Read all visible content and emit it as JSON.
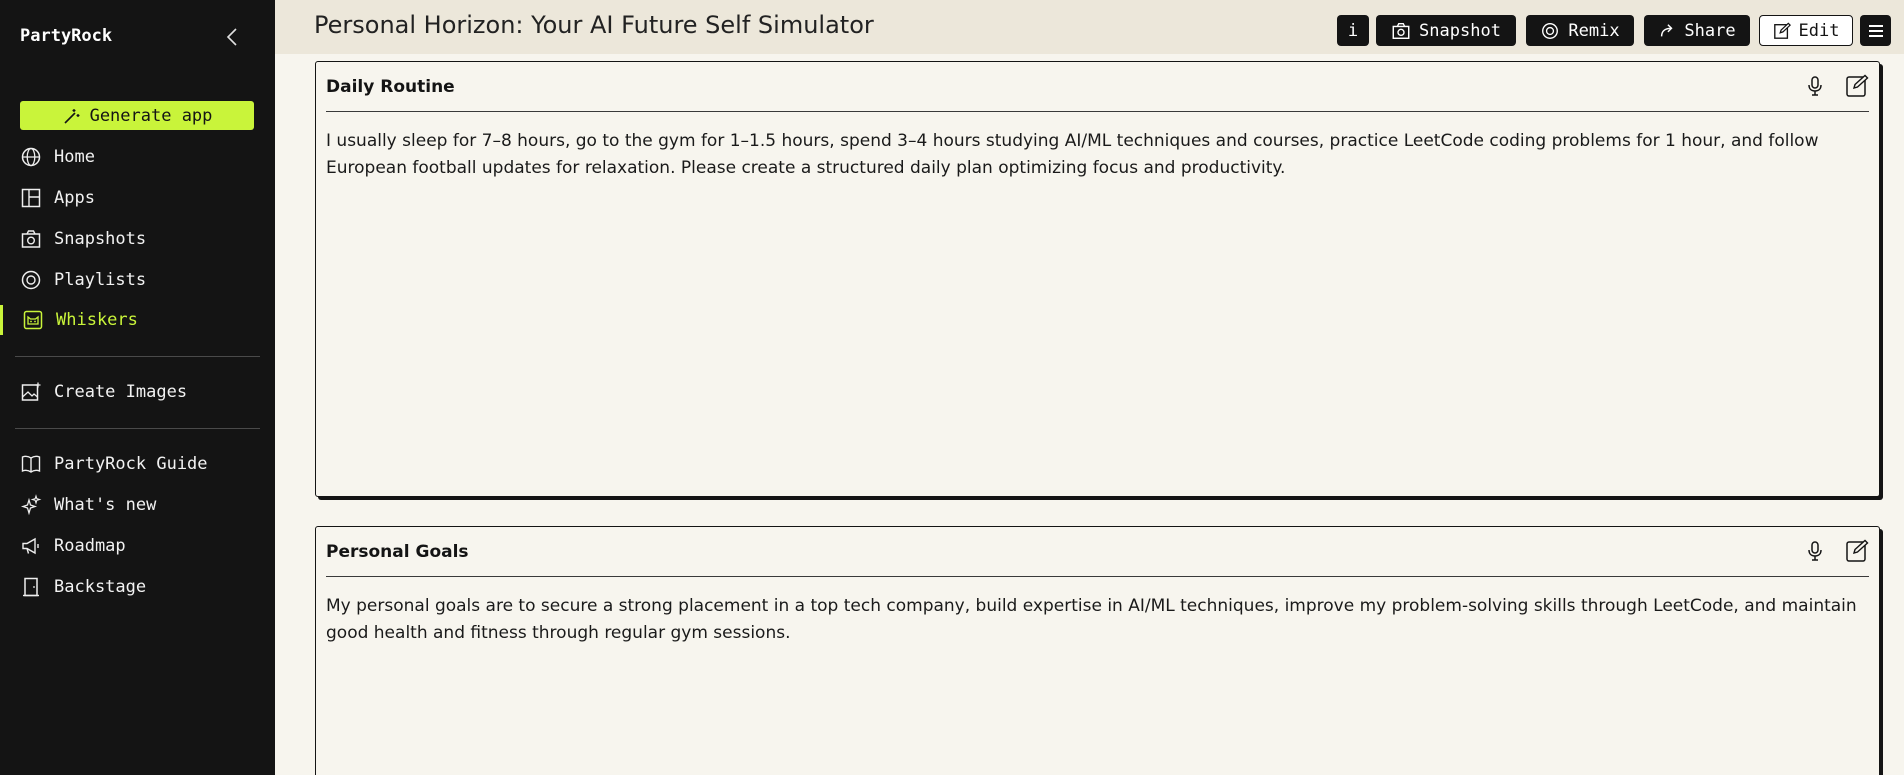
{
  "sidebar": {
    "brand": "PartyRock",
    "generate_label": "Generate app",
    "items": [
      {
        "label": "Home",
        "icon": "globe-icon"
      },
      {
        "label": "Apps",
        "icon": "layout-icon"
      },
      {
        "label": "Snapshots",
        "icon": "camera-icon"
      },
      {
        "label": "Playlists",
        "icon": "playlist-icon"
      },
      {
        "label": "Whiskers",
        "icon": "cat-icon",
        "active": true
      }
    ],
    "create_images_label": "Create Images",
    "bottom_items": [
      {
        "label": "PartyRock Guide",
        "icon": "book-icon"
      },
      {
        "label": "What's new",
        "icon": "sparkle-icon"
      },
      {
        "label": "Roadmap",
        "icon": "megaphone-icon"
      },
      {
        "label": "Backstage",
        "icon": "door-icon"
      }
    ],
    "accent_color": "#c9f43a"
  },
  "header": {
    "title": "Personal Horizon: Your AI Future Self Simulator",
    "info_label": "i",
    "snapshot_label": "Snapshot",
    "remix_label": "Remix",
    "share_label": "Share",
    "edit_label": "Edit"
  },
  "cards": [
    {
      "title": "Daily Routine",
      "text": "I usually sleep for 7–8 hours, go to the gym for 1–1.5 hours, spend 3–4 hours studying AI/ML techniques and courses, practice LeetCode coding problems for 1 hour, and follow European football updates for relaxation. Please create a structured daily plan optimizing focus and productivity."
    },
    {
      "title": "Personal Goals",
      "text": "My personal goals are to secure a strong placement in a top tech company, build expertise in AI/ML techniques, improve my problem-solving skills through LeetCode, and maintain good health and fitness through regular gym sessions."
    }
  ]
}
